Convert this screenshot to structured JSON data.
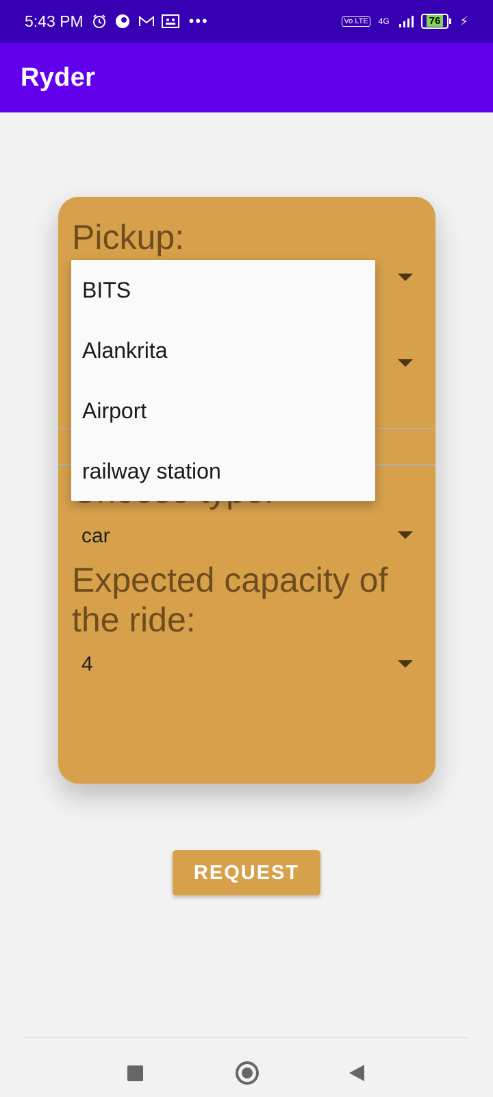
{
  "status_bar": {
    "time": "5:43 PM",
    "network": "4G",
    "volte": "Vo LTE",
    "battery": "76",
    "icons": [
      "alarm-icon",
      "app-icon",
      "gmail-icon",
      "notification-icon",
      "more-dots-icon",
      "signal-icon",
      "battery-icon",
      "charging-icon"
    ]
  },
  "app_bar": {
    "title": "Ryder"
  },
  "form": {
    "pickup_label": "Pickup:",
    "choose_type_label": "Choose type:",
    "type_value": "car",
    "capacity_label": "Expected capacity of the ride:",
    "capacity_value": "4"
  },
  "pickup_dropdown": {
    "options": [
      "BITS",
      "Alankrita",
      "Airport",
      "railway station"
    ]
  },
  "request_button": {
    "label": "REQUEST"
  },
  "colors": {
    "status_bar": "#3700b3",
    "app_bar": "#6200ee",
    "card": "#d7a14b",
    "label_text": "#6f4c1d"
  }
}
